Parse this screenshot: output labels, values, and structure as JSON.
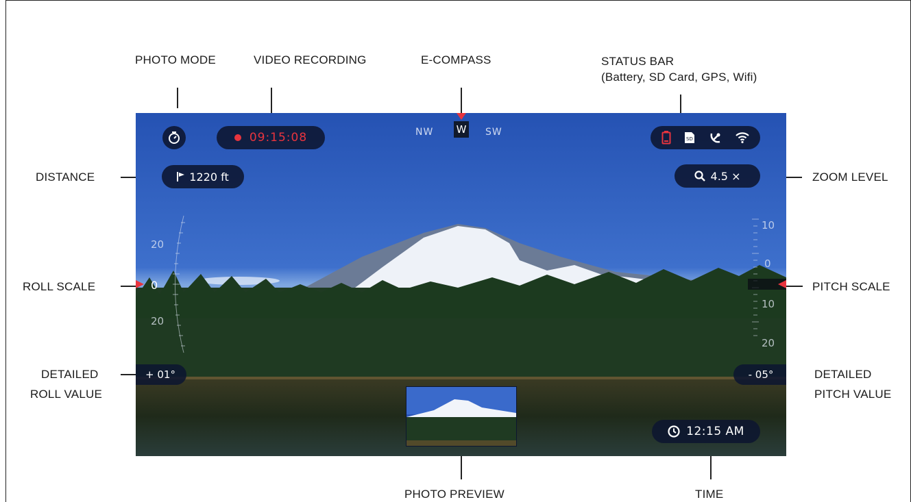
{
  "labels": {
    "photo_mode": "PHOTO MODE",
    "video_recording": "VIDEO RECORDING",
    "e_compass": "E-COMPASS",
    "status_bar": "STATUS BAR",
    "status_bar_sub": "(Battery, SD Card, GPS, Wifi)",
    "distance": "DISTANCE",
    "zoom_level": "ZOOM LEVEL",
    "roll_scale": "ROLL SCALE",
    "pitch_scale": "PITCH SCALE",
    "detailed_roll_1": "DETAILED",
    "detailed_roll_2": "ROLL VALUE",
    "detailed_pitch_1": "DETAILED",
    "detailed_pitch_2": "PITCH VALUE",
    "photo_preview": "PHOTO PREVIEW",
    "time": "TIME"
  },
  "screen": {
    "recording_time": "09:15:08",
    "compass": {
      "left": "NW",
      "center": "W",
      "right": "SW"
    },
    "distance": "1220 ft",
    "zoom": "4.5 ×",
    "roll_value": "+ 01°",
    "pitch_value": "- 05°",
    "clock": "12:15 AM",
    "roll_scale_ticks": {
      "top": "20",
      "center": "0",
      "bottom": "20"
    },
    "pitch_scale_ticks": {
      "t1": "10",
      "t2": "0",
      "t3": "10",
      "t4": "20"
    },
    "status_icons": [
      "battery-icon",
      "sd-card-icon",
      "gps-icon",
      "wifi-icon"
    ]
  },
  "colors": {
    "accent_red": "#e8343e",
    "hud_bg": "#0c1630",
    "sky": "#2a55b6"
  }
}
